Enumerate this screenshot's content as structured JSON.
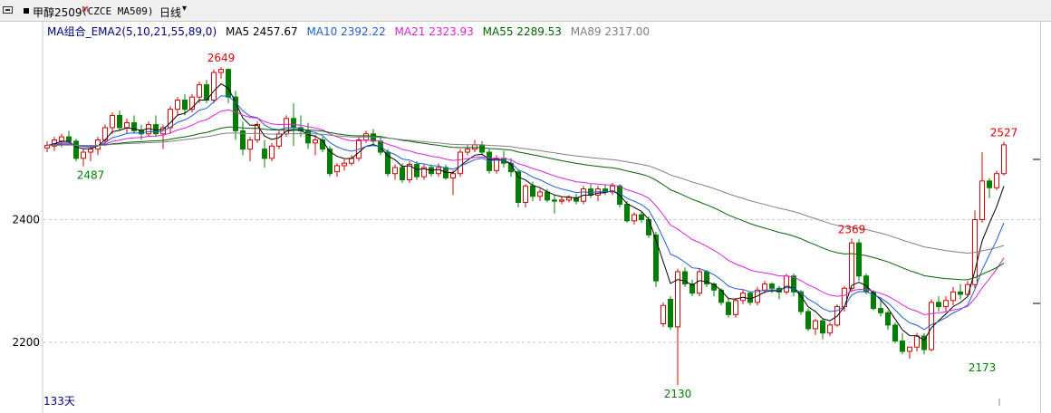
{
  "toolbar": {
    "title": "甲醇2509",
    "title_sup": "M",
    "code": "(CZCE MA509)",
    "period": "日线",
    "period_arrow": "▾"
  },
  "indicator": {
    "name": "MA组合_EMA2(5,10,21,55,89,0)",
    "values": [
      {
        "label": "MA5 2457.67",
        "color": "#000000"
      },
      {
        "label": "MA10 2392.22",
        "color": "#1f5fd6"
      },
      {
        "label": "MA21 2323.93",
        "color": "#e020e0"
      },
      {
        "label": "MA55 2289.53",
        "color": "#006400"
      },
      {
        "label": "MA89 2317.00",
        "color": "#808080"
      }
    ]
  },
  "days_label": "133天",
  "colors": {
    "up": "#e00000",
    "down": "#008000",
    "grid": "#c8c8c8"
  },
  "chart_data": {
    "type": "candlestick",
    "ylim": [
      2117,
      2711
    ],
    "yticks": [
      2200,
      2400
    ],
    "grid": "horizontal dashed",
    "bars": [
      {
        "o": 2517,
        "h": 2528,
        "l": 2510,
        "c": 2521
      },
      {
        "o": 2520,
        "h": 2535,
        "l": 2512,
        "c": 2530
      },
      {
        "o": 2528,
        "h": 2540,
        "l": 2518,
        "c": 2535
      },
      {
        "o": 2535,
        "h": 2545,
        "l": 2525,
        "c": 2528
      },
      {
        "o": 2528,
        "h": 2532,
        "l": 2495,
        "c": 2500
      },
      {
        "o": 2500,
        "h": 2515,
        "l": 2487,
        "c": 2510
      },
      {
        "o": 2510,
        "h": 2522,
        "l": 2495,
        "c": 2515
      },
      {
        "o": 2515,
        "h": 2535,
        "l": 2505,
        "c": 2530
      },
      {
        "o": 2530,
        "h": 2555,
        "l": 2520,
        "c": 2550
      },
      {
        "o": 2550,
        "h": 2575,
        "l": 2540,
        "c": 2570
      },
      {
        "o": 2570,
        "h": 2578,
        "l": 2545,
        "c": 2550
      },
      {
        "o": 2550,
        "h": 2565,
        "l": 2540,
        "c": 2558
      },
      {
        "o": 2558,
        "h": 2570,
        "l": 2540,
        "c": 2545
      },
      {
        "o": 2545,
        "h": 2555,
        "l": 2530,
        "c": 2540
      },
      {
        "o": 2540,
        "h": 2560,
        "l": 2535,
        "c": 2555
      },
      {
        "o": 2555,
        "h": 2570,
        "l": 2535,
        "c": 2540
      },
      {
        "o": 2540,
        "h": 2555,
        "l": 2515,
        "c": 2550
      },
      {
        "o": 2550,
        "h": 2585,
        "l": 2540,
        "c": 2580
      },
      {
        "o": 2580,
        "h": 2600,
        "l": 2570,
        "c": 2595
      },
      {
        "o": 2595,
        "h": 2605,
        "l": 2570,
        "c": 2580
      },
      {
        "o": 2580,
        "h": 2605,
        "l": 2575,
        "c": 2600
      },
      {
        "o": 2600,
        "h": 2625,
        "l": 2590,
        "c": 2620
      },
      {
        "o": 2620,
        "h": 2628,
        "l": 2590,
        "c": 2595
      },
      {
        "o": 2595,
        "h": 2645,
        "l": 2590,
        "c": 2640
      },
      {
        "o": 2640,
        "h": 2649,
        "l": 2630,
        "c": 2645
      },
      {
        "o": 2645,
        "h": 2647,
        "l": 2590,
        "c": 2600
      },
      {
        "o": 2600,
        "h": 2610,
        "l": 2530,
        "c": 2545
      },
      {
        "o": 2545,
        "h": 2560,
        "l": 2505,
        "c": 2515
      },
      {
        "o": 2515,
        "h": 2535,
        "l": 2495,
        "c": 2530
      },
      {
        "o": 2530,
        "h": 2560,
        "l": 2525,
        "c": 2555
      },
      {
        "o": 2515,
        "h": 2530,
        "l": 2485,
        "c": 2500
      },
      {
        "o": 2500,
        "h": 2525,
        "l": 2495,
        "c": 2520
      },
      {
        "o": 2520,
        "h": 2545,
        "l": 2515,
        "c": 2540
      },
      {
        "o": 2540,
        "h": 2570,
        "l": 2535,
        "c": 2565
      },
      {
        "o": 2565,
        "h": 2590,
        "l": 2520,
        "c": 2550
      },
      {
        "o": 2550,
        "h": 2570,
        "l": 2535,
        "c": 2545
      },
      {
        "o": 2545,
        "h": 2558,
        "l": 2515,
        "c": 2525
      },
      {
        "o": 2525,
        "h": 2538,
        "l": 2505,
        "c": 2530
      },
      {
        "o": 2530,
        "h": 2535,
        "l": 2510,
        "c": 2515
      },
      {
        "o": 2515,
        "h": 2520,
        "l": 2470,
        "c": 2475
      },
      {
        "o": 2478,
        "h": 2492,
        "l": 2470,
        "c": 2488
      },
      {
        "o": 2488,
        "h": 2498,
        "l": 2480,
        "c": 2492
      },
      {
        "o": 2492,
        "h": 2505,
        "l": 2488,
        "c": 2500
      },
      {
        "o": 2500,
        "h": 2535,
        "l": 2495,
        "c": 2530
      },
      {
        "o": 2530,
        "h": 2545,
        "l": 2525,
        "c": 2540
      },
      {
        "o": 2540,
        "h": 2548,
        "l": 2520,
        "c": 2528
      },
      {
        "o": 2528,
        "h": 2535,
        "l": 2505,
        "c": 2510
      },
      {
        "o": 2510,
        "h": 2515,
        "l": 2470,
        "c": 2475
      },
      {
        "o": 2475,
        "h": 2490,
        "l": 2465,
        "c": 2485
      },
      {
        "o": 2485,
        "h": 2492,
        "l": 2460,
        "c": 2465
      },
      {
        "o": 2465,
        "h": 2495,
        "l": 2460,
        "c": 2490
      },
      {
        "o": 2490,
        "h": 2495,
        "l": 2465,
        "c": 2470
      },
      {
        "o": 2470,
        "h": 2490,
        "l": 2465,
        "c": 2485
      },
      {
        "o": 2485,
        "h": 2490,
        "l": 2470,
        "c": 2475
      },
      {
        "o": 2475,
        "h": 2492,
        "l": 2470,
        "c": 2485
      },
      {
        "o": 2485,
        "h": 2490,
        "l": 2465,
        "c": 2468
      },
      {
        "o": 2468,
        "h": 2480,
        "l": 2440,
        "c": 2475
      },
      {
        "o": 2475,
        "h": 2515,
        "l": 2470,
        "c": 2510
      },
      {
        "o": 2510,
        "h": 2522,
        "l": 2505,
        "c": 2515
      },
      {
        "o": 2515,
        "h": 2530,
        "l": 2510,
        "c": 2522
      },
      {
        "o": 2522,
        "h": 2528,
        "l": 2505,
        "c": 2510
      },
      {
        "o": 2510,
        "h": 2515,
        "l": 2475,
        "c": 2480
      },
      {
        "o": 2480,
        "h": 2505,
        "l": 2475,
        "c": 2500
      },
      {
        "o": 2500,
        "h": 2512,
        "l": 2485,
        "c": 2492
      },
      {
        "o": 2492,
        "h": 2500,
        "l": 2470,
        "c": 2478
      },
      {
        "o": 2478,
        "h": 2482,
        "l": 2420,
        "c": 2428
      },
      {
        "o": 2428,
        "h": 2458,
        "l": 2420,
        "c": 2455
      },
      {
        "o": 2455,
        "h": 2462,
        "l": 2430,
        "c": 2438
      },
      {
        "o": 2438,
        "h": 2450,
        "l": 2430,
        "c": 2445
      },
      {
        "o": 2445,
        "h": 2450,
        "l": 2428,
        "c": 2432
      },
      {
        "o": 2432,
        "h": 2440,
        "l": 2410,
        "c": 2430
      },
      {
        "o": 2430,
        "h": 2438,
        "l": 2425,
        "c": 2432
      },
      {
        "o": 2432,
        "h": 2440,
        "l": 2428,
        "c": 2436
      },
      {
        "o": 2436,
        "h": 2442,
        "l": 2425,
        "c": 2430
      },
      {
        "o": 2430,
        "h": 2455,
        "l": 2425,
        "c": 2450
      },
      {
        "o": 2450,
        "h": 2458,
        "l": 2435,
        "c": 2440
      },
      {
        "o": 2440,
        "h": 2455,
        "l": 2430,
        "c": 2450
      },
      {
        "o": 2450,
        "h": 2458,
        "l": 2440,
        "c": 2445
      },
      {
        "o": 2445,
        "h": 2460,
        "l": 2440,
        "c": 2455
      },
      {
        "o": 2455,
        "h": 2458,
        "l": 2420,
        "c": 2425
      },
      {
        "o": 2425,
        "h": 2430,
        "l": 2395,
        "c": 2398
      },
      {
        "o": 2398,
        "h": 2412,
        "l": 2392,
        "c": 2408
      },
      {
        "o": 2408,
        "h": 2412,
        "l": 2395,
        "c": 2400
      },
      {
        "o": 2400,
        "h": 2405,
        "l": 2370,
        "c": 2375
      },
      {
        "o": 2375,
        "h": 2380,
        "l": 2290,
        "c": 2300
      },
      {
        "o": 2230,
        "h": 2265,
        "l": 2225,
        "c": 2260
      },
      {
        "o": 2270,
        "h": 2275,
        "l": 2220,
        "c": 2225
      },
      {
        "o": 2225,
        "h": 2320,
        "l": 2130,
        "c": 2315
      },
      {
        "o": 2315,
        "h": 2322,
        "l": 2290,
        "c": 2295
      },
      {
        "o": 2295,
        "h": 2302,
        "l": 2275,
        "c": 2280
      },
      {
        "o": 2280,
        "h": 2320,
        "l": 2275,
        "c": 2315
      },
      {
        "o": 2315,
        "h": 2318,
        "l": 2290,
        "c": 2295
      },
      {
        "o": 2295,
        "h": 2298,
        "l": 2275,
        "c": 2285
      },
      {
        "o": 2285,
        "h": 2288,
        "l": 2260,
        "c": 2265
      },
      {
        "o": 2265,
        "h": 2272,
        "l": 2240,
        "c": 2245
      },
      {
        "o": 2245,
        "h": 2272,
        "l": 2240,
        "c": 2268
      },
      {
        "o": 2268,
        "h": 2285,
        "l": 2262,
        "c": 2280
      },
      {
        "o": 2280,
        "h": 2282,
        "l": 2260,
        "c": 2265
      },
      {
        "o": 2265,
        "h": 2290,
        "l": 2260,
        "c": 2285
      },
      {
        "o": 2285,
        "h": 2300,
        "l": 2280,
        "c": 2295
      },
      {
        "o": 2295,
        "h": 2298,
        "l": 2280,
        "c": 2288
      },
      {
        "o": 2288,
        "h": 2292,
        "l": 2270,
        "c": 2282
      },
      {
        "o": 2282,
        "h": 2312,
        "l": 2278,
        "c": 2308
      },
      {
        "o": 2308,
        "h": 2312,
        "l": 2275,
        "c": 2282
      },
      {
        "o": 2282,
        "h": 2285,
        "l": 2245,
        "c": 2250
      },
      {
        "o": 2250,
        "h": 2255,
        "l": 2218,
        "c": 2222
      },
      {
        "o": 2222,
        "h": 2238,
        "l": 2212,
        "c": 2235
      },
      {
        "o": 2235,
        "h": 2238,
        "l": 2205,
        "c": 2215
      },
      {
        "o": 2215,
        "h": 2232,
        "l": 2210,
        "c": 2228
      },
      {
        "o": 2228,
        "h": 2262,
        "l": 2225,
        "c": 2258
      },
      {
        "o": 2258,
        "h": 2292,
        "l": 2250,
        "c": 2288
      },
      {
        "o": 2288,
        "h": 2369,
        "l": 2282,
        "c": 2362
      },
      {
        "o": 2362,
        "h": 2368,
        "l": 2300,
        "c": 2308
      },
      {
        "o": 2308,
        "h": 2312,
        "l": 2278,
        "c": 2282
      },
      {
        "o": 2282,
        "h": 2285,
        "l": 2252,
        "c": 2255
      },
      {
        "o": 2255,
        "h": 2270,
        "l": 2242,
        "c": 2248
      },
      {
        "o": 2248,
        "h": 2252,
        "l": 2220,
        "c": 2228
      },
      {
        "o": 2228,
        "h": 2232,
        "l": 2198,
        "c": 2202
      },
      {
        "o": 2202,
        "h": 2215,
        "l": 2180,
        "c": 2185
      },
      {
        "o": 2185,
        "h": 2192,
        "l": 2173,
        "c": 2192
      },
      {
        "o": 2192,
        "h": 2215,
        "l": 2185,
        "c": 2210
      },
      {
        "o": 2210,
        "h": 2215,
        "l": 2180,
        "c": 2188
      },
      {
        "o": 2188,
        "h": 2270,
        "l": 2185,
        "c": 2265
      },
      {
        "o": 2265,
        "h": 2275,
        "l": 2250,
        "c": 2258
      },
      {
        "o": 2258,
        "h": 2275,
        "l": 2250,
        "c": 2268
      },
      {
        "o": 2268,
        "h": 2290,
        "l": 2260,
        "c": 2282
      },
      {
        "o": 2282,
        "h": 2295,
        "l": 2270,
        "c": 2278
      },
      {
        "o": 2278,
        "h": 2300,
        "l": 2275,
        "c": 2294
      },
      {
        "o": 2294,
        "h": 2415,
        "l": 2288,
        "c": 2400
      },
      {
        "o": 2400,
        "h": 2510,
        "l": 2395,
        "c": 2463
      },
      {
        "o": 2463,
        "h": 2468,
        "l": 2435,
        "c": 2452
      },
      {
        "o": 2452,
        "h": 2480,
        "l": 2448,
        "c": 2475
      },
      {
        "o": 2475,
        "h": 2527,
        "l": 2472,
        "c": 2522
      }
    ],
    "annotations": [
      {
        "bar": 24,
        "price": 2649,
        "text": "2649",
        "pos": "above",
        "color": "#e00000"
      },
      {
        "bar": 6,
        "price": 2487,
        "text": "2487",
        "pos": "below",
        "color": "#008000"
      },
      {
        "bar": 87,
        "price": 2130,
        "text": "2130",
        "pos": "below",
        "color": "#008000"
      },
      {
        "bar": 111,
        "price": 2369,
        "text": "2369",
        "pos": "above",
        "color": "#e00000"
      },
      {
        "bar": 129,
        "price": 2173,
        "text": "2173",
        "pos": "below",
        "color": "#008000"
      },
      {
        "bar": 132,
        "price": 2527,
        "text": "2527",
        "pos": "above",
        "color": "#e00000"
      }
    ],
    "ma_series": [
      {
        "name": "MA5",
        "period": 5,
        "color": "#000000"
      },
      {
        "name": "MA10",
        "period": 10,
        "color": "#1f5fd6"
      },
      {
        "name": "MA21",
        "period": 21,
        "color": "#e020e0"
      },
      {
        "name": "MA55",
        "period": 55,
        "color": "#006400"
      },
      {
        "name": "MA89",
        "period": 89,
        "color": "#808080"
      }
    ]
  }
}
